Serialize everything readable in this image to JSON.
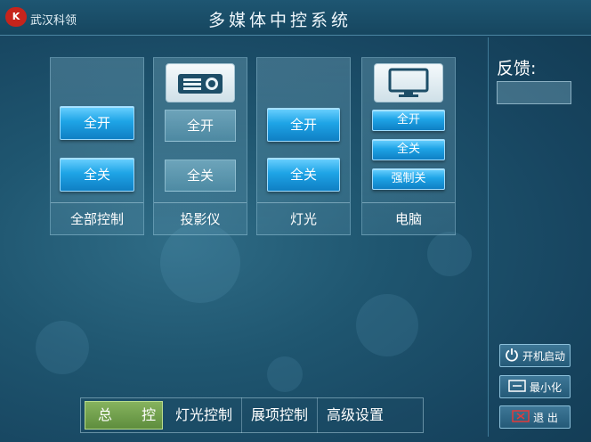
{
  "header": {
    "logo_text": "K",
    "company": "武汉科领",
    "title": "多媒体中控系统"
  },
  "panels": [
    {
      "label": "全部控制",
      "buttons": [
        "全开",
        "全关"
      ]
    },
    {
      "label": "投影仪",
      "icon": "projector-icon",
      "buttons": [
        "全开",
        "全关"
      ]
    },
    {
      "label": "灯光",
      "buttons": [
        "全开",
        "全关"
      ]
    },
    {
      "label": "电脑",
      "icon": "monitor-icon",
      "buttons": [
        "全开",
        "全关",
        "强制关"
      ]
    }
  ],
  "tabs": [
    {
      "label": "总 控",
      "active": true
    },
    {
      "label": "灯光控制",
      "active": false
    },
    {
      "label": "展项控制",
      "active": false
    },
    {
      "label": "高级设置",
      "active": false
    }
  ],
  "feedback": {
    "label": "反馈:",
    "value": ""
  },
  "side_buttons": {
    "power_on": "开机启动",
    "minimize": "最小化",
    "exit": "退 出"
  },
  "colors": {
    "accent_blue": "#1ea4e6",
    "active_tab_green": "#6f9f4a",
    "background": "#1f5670",
    "exit_red": "#e23b3b"
  }
}
